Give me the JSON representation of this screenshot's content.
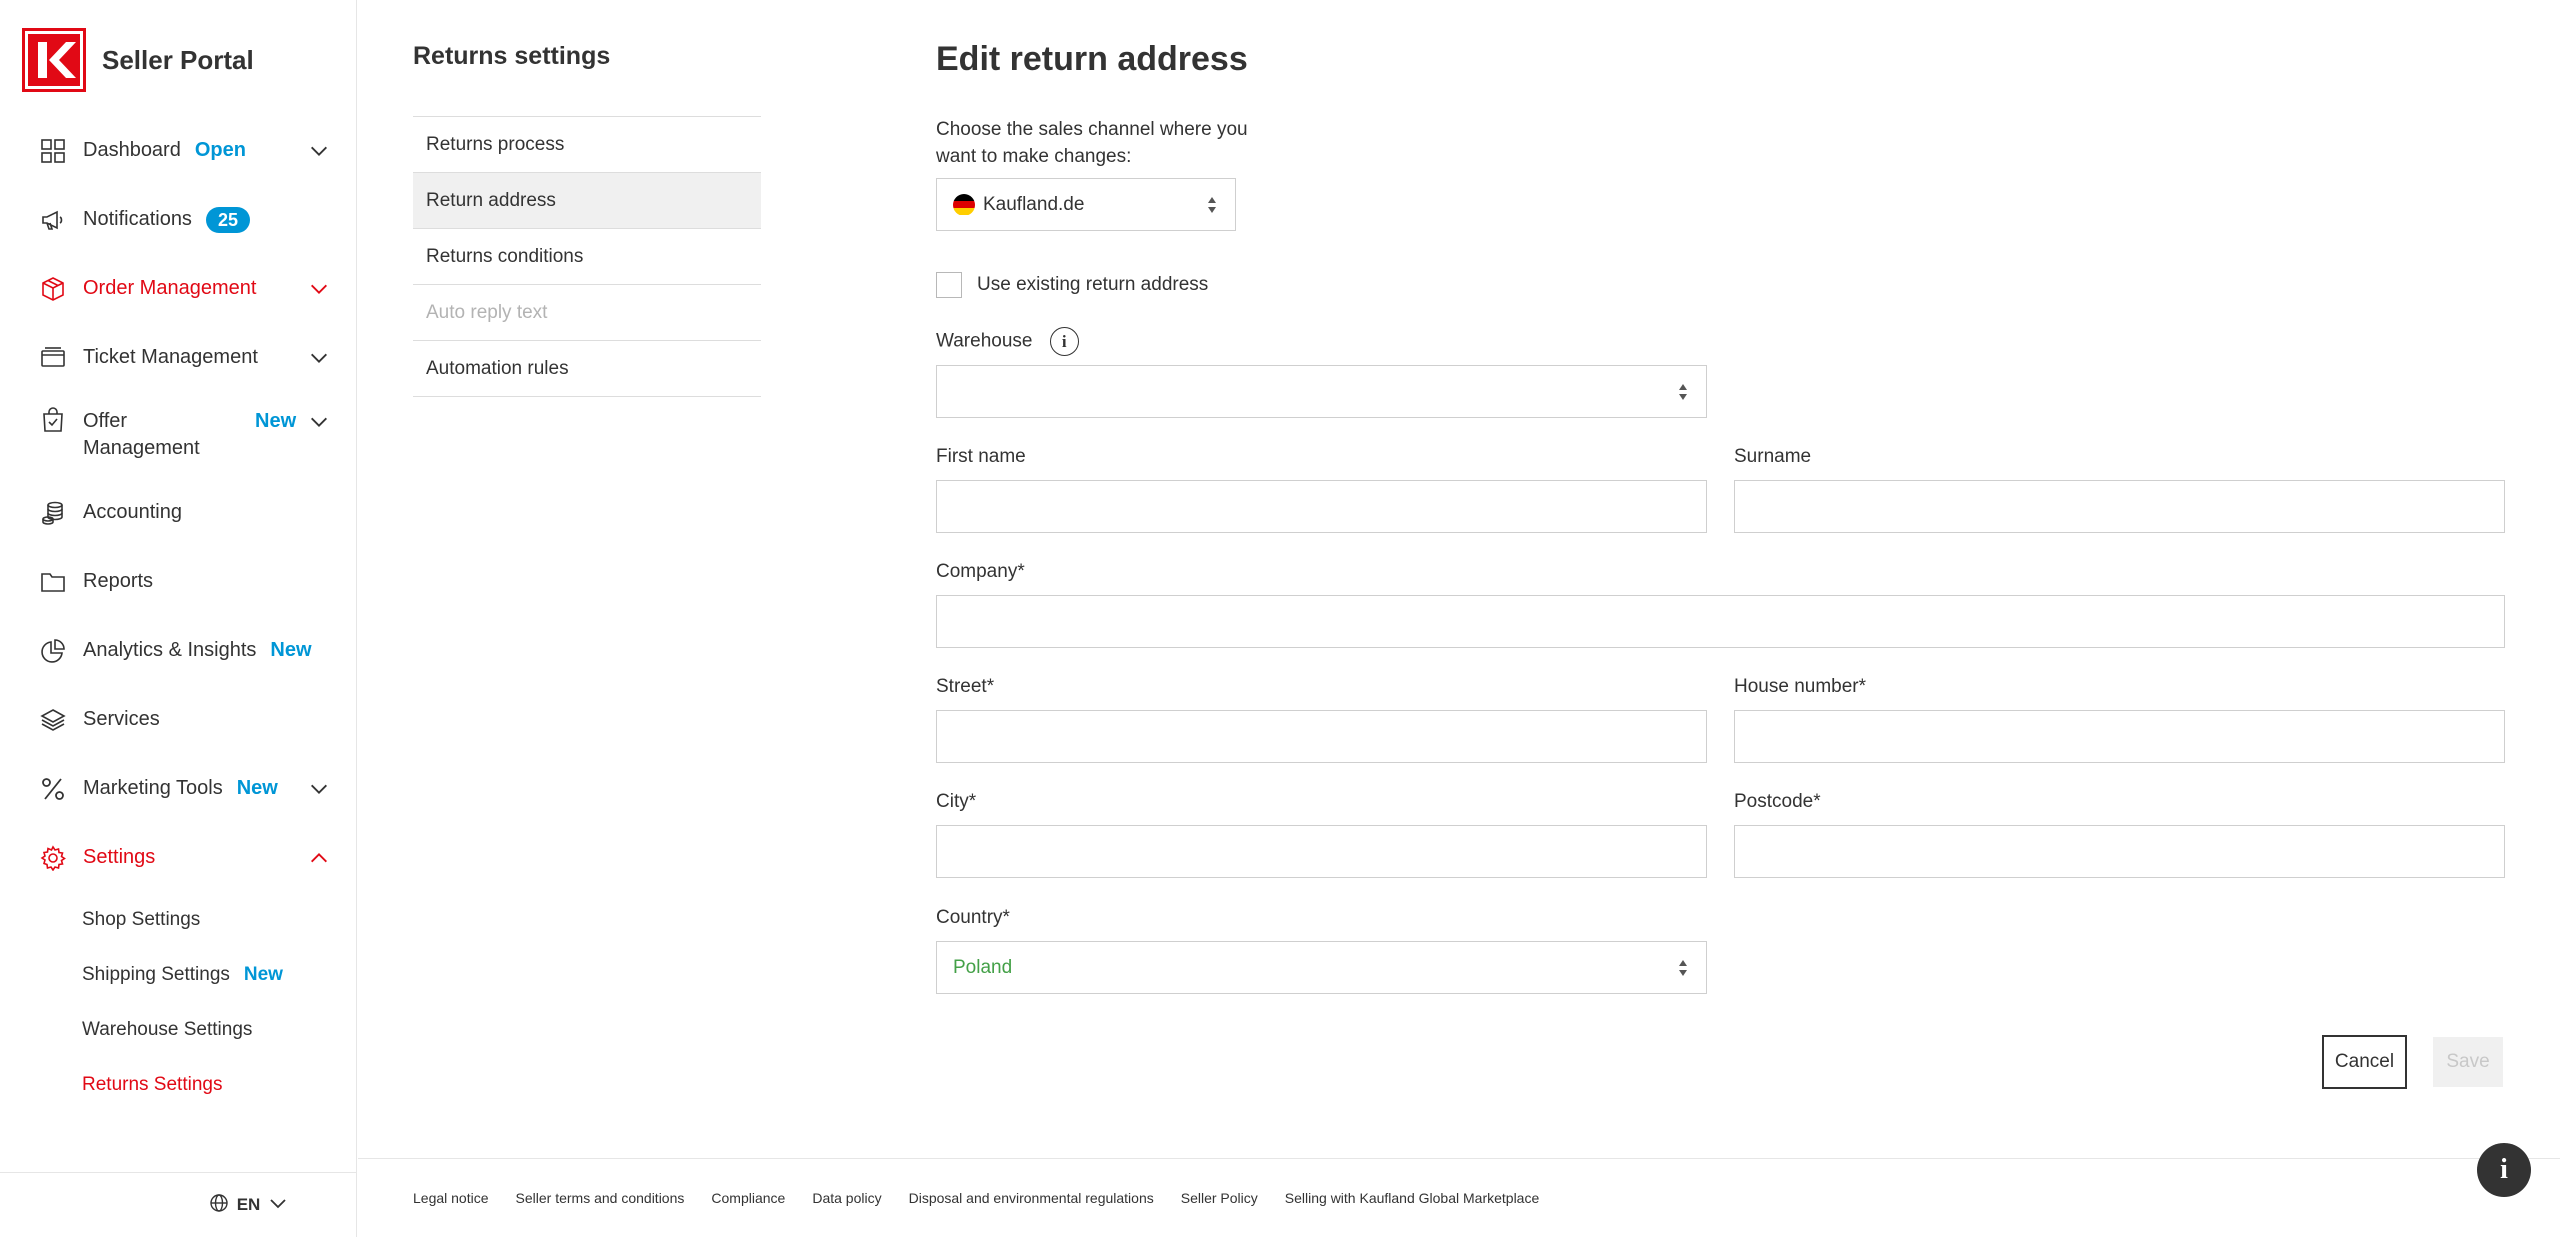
{
  "brand": {
    "name": "Seller Portal"
  },
  "nav": {
    "dashboard": {
      "label": "Dashboard",
      "badge": "Open"
    },
    "notifications": {
      "label": "Notifications",
      "count": "25"
    },
    "order_management": {
      "label": "Order Management"
    },
    "ticket_management": {
      "label": "Ticket Management"
    },
    "offer_management": {
      "label_line1": "Offer",
      "label_line2": "Management",
      "badge": "New"
    },
    "accounting": {
      "label": "Accounting"
    },
    "reports": {
      "label": "Reports"
    },
    "analytics": {
      "label": "Analytics & Insights",
      "badge": "New"
    },
    "services": {
      "label": "Services"
    },
    "marketing": {
      "label": "Marketing Tools",
      "badge": "New"
    },
    "settings": {
      "label": "Settings"
    },
    "sub": {
      "shop": "Shop Settings",
      "shipping": "Shipping Settings",
      "shipping_badge": "New",
      "warehouse": "Warehouse Settings",
      "returns": "Returns Settings"
    }
  },
  "language": {
    "code": "EN"
  },
  "returns_settings": {
    "title": "Returns settings",
    "items": [
      "Returns process",
      "Return address",
      "Returns conditions",
      "Auto reply text",
      "Automation rules"
    ]
  },
  "form": {
    "title": "Edit return address",
    "help_text": "Choose the sales channel where you want to make changes:",
    "sales_channel": "Kaufland.de",
    "use_existing_label": "Use existing return address",
    "warehouse_label": "Warehouse",
    "warehouse_value": "",
    "first_name_label": "First name",
    "surname_label": "Surname",
    "company_label": "Company*",
    "street_label": "Street*",
    "house_number_label": "House number*",
    "city_label": "City*",
    "postcode_label": "Postcode*",
    "country_label": "Country*",
    "country_value": "Poland",
    "cancel": "Cancel",
    "save": "Save"
  },
  "footer": {
    "links": [
      "Legal notice",
      "Seller terms and conditions",
      "Compliance",
      "Data policy",
      "Disposal and environmental regulations",
      "Seller Policy",
      "Selling with Kaufland Global Marketplace"
    ]
  },
  "colors": {
    "brand_red": "#e10915",
    "accent_blue": "#0096d6",
    "country_green": "#43a047"
  }
}
